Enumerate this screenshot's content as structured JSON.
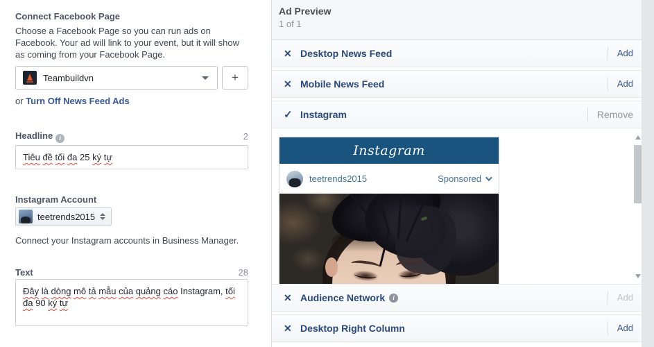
{
  "left_panel": {
    "connect": {
      "title": "Connect Facebook Page",
      "description": "Choose a Facebook Page so you can run ads on Facebook. Your ad will link to your event, but it will show as coming from your Facebook Page.",
      "page_name": "Teambuildvn",
      "add_button": "+",
      "or_text": "or",
      "turn_off_link": "Turn Off News Feed Ads"
    },
    "headline": {
      "label": "Headline",
      "count": "2",
      "value": "Tiêu đề tối đa 25 ký tự"
    },
    "instagram_account": {
      "label": "Instagram Account",
      "selected": "teetrends2015",
      "help": "Connect your Instagram accounts in Business Manager."
    },
    "text": {
      "label": "Text",
      "count": "28",
      "value": "Đây là dòng mô tả mẫu của quảng cáo Instagram, tối đa 90 ký tự"
    }
  },
  "ad_preview": {
    "title": "Ad Preview",
    "pagination": "1 of 1",
    "placements": [
      {
        "name": "Desktop News Feed",
        "icon": "x-icon",
        "action": "Add",
        "enabled": true
      },
      {
        "name": "Mobile News Feed",
        "icon": "x-icon",
        "action": "Add",
        "enabled": true
      },
      {
        "name": "Instagram",
        "icon": "check-icon",
        "action": "Remove",
        "enabled": true
      },
      {
        "name": "Audience Network",
        "icon": "x-icon",
        "action": "Add",
        "enabled": false,
        "info": true
      },
      {
        "name": "Desktop Right Column",
        "icon": "x-icon",
        "action": "Add",
        "enabled": true
      }
    ],
    "instagram_card": {
      "logo": "Instagram",
      "username": "teetrends2015",
      "sponsored": "Sponsored"
    }
  },
  "colors": {
    "accent_blue": "#365899",
    "row_title_blue": "#29487d",
    "instagram_bar": "#19547f",
    "instagram_link": "#3f729b",
    "disabled_gray": "#bdc2c8"
  }
}
